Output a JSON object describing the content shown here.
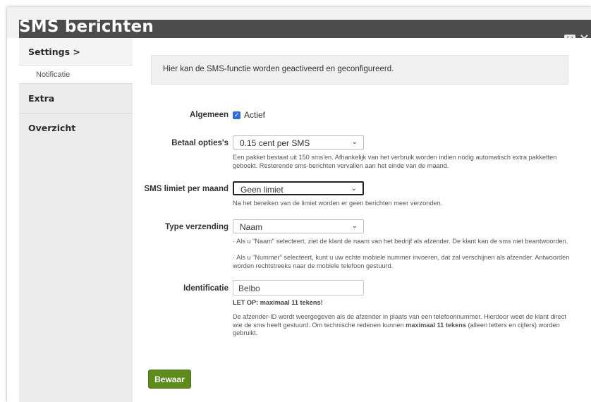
{
  "window": {
    "title": "SMS berichten",
    "expand_icon": "expand-icon",
    "close_icon": "close-icon"
  },
  "sidebar": {
    "settings_label": "Settings >",
    "sub_item": "Notificatie",
    "items": [
      {
        "label": "Extra"
      },
      {
        "label": "Overzicht"
      }
    ]
  },
  "content": {
    "info": "Hier kan de SMS-functie worden geactiveerd en geconfigureerd.",
    "general": {
      "label": "Algemeen",
      "checkbox_label": "Actief",
      "checked": true
    },
    "payment": {
      "label": "Betaal opties's",
      "selected": "0.15 cent per SMS",
      "help": "Een pakket bestaat uit 150 sms'en. Afhankelijk van het verbruik worden indien nodig automatisch extra pakketten geboekt. Resterende sms-berichten vervallen aan het einde van de maand."
    },
    "limit": {
      "label": "SMS limiet per maand",
      "selected": "Geen limiet",
      "help": "Na het bereiken van de limiet worden er geen berichten meer verzonden."
    },
    "sendtype": {
      "label": "Type verzending",
      "selected": "Naam",
      "help1": "· Als u \"Naam\" selecteert, ziet de klant de naam van het bedrijf als afzender. De klant kan de sms niet beantwoorden.",
      "help2": "· Als u \"Nummer\" selecteert, kunt u uw echte mobiele nummer invoeren, dat zal verschijnen als afzender. Antwoorden worden rechtstreeks naar de mobiele telefoon gestuurd."
    },
    "identification": {
      "label": "Identificatie",
      "value": "Belbo",
      "warning": "LET OP: maximaal 11 tekens!",
      "help_part1": "De afzender-ID wordt weergegeven als de afzender in plaats van een telefoonnummer. Hierdoor weet de klant direct wie de sms heeft gestuurd. Om technische redenen kunnen ",
      "help_bold": "maximaal 11 tekens",
      "help_part2": " (alleen letters en cijfers) worden gebruikt."
    },
    "save_label": "Bewaar"
  },
  "colors": {
    "titlebar": "#4c4c4c",
    "sidebar": "#ececec",
    "checkbox": "#2d6fd6",
    "save_button": "#5d8c1c"
  }
}
